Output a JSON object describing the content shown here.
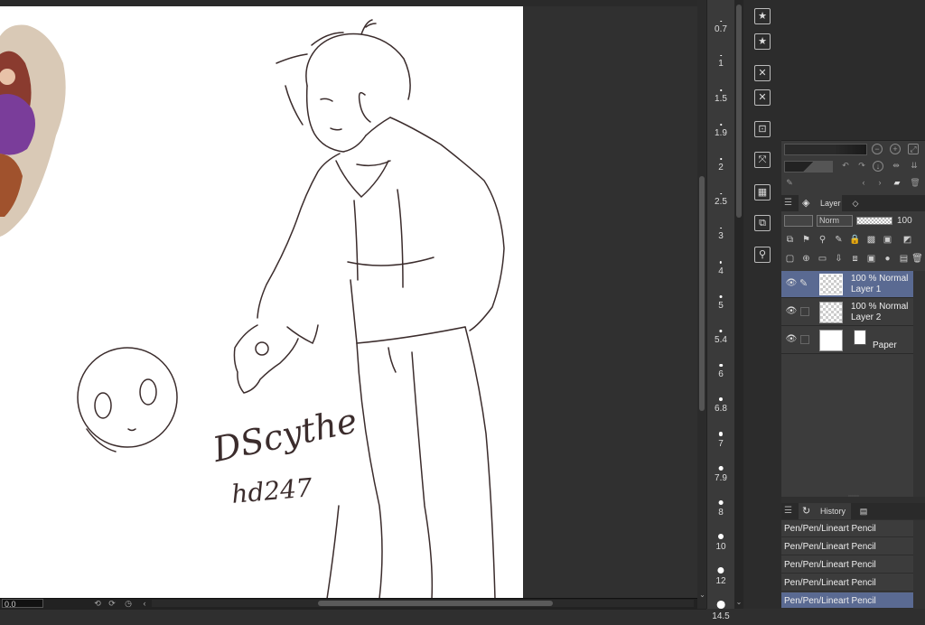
{
  "canvas": {
    "signature_line1": "DScythe",
    "signature_line2": "hd247"
  },
  "bottom_bar": {
    "zoom_value": "0.0"
  },
  "brush_size_palette": {
    "sizes": [
      "0.7",
      "1",
      "1.5",
      "1.9",
      "2",
      "2.5",
      "3",
      "4",
      "5",
      "5.4",
      "6",
      "6.8",
      "7",
      "7.9",
      "8",
      "10",
      "12",
      "14.5"
    ]
  },
  "layer_panel": {
    "tab_label": "Layer",
    "blend_mode": "Norm",
    "opacity": "100",
    "layers": [
      {
        "line1": "100 % Normal",
        "line2": "Layer 1",
        "selected": true
      },
      {
        "line1": "100 % Normal",
        "line2": "Layer 2",
        "selected": false
      },
      {
        "line1": "",
        "line2": "Paper",
        "selected": false
      }
    ]
  },
  "history_panel": {
    "tab_label": "History",
    "items": [
      "Pen/Pen/Lineart Pencil",
      "Pen/Pen/Lineart Pencil",
      "Pen/Pen/Lineart Pencil",
      "Pen/Pen/Lineart Pencil",
      "Pen/Pen/Lineart Pencil"
    ]
  },
  "colors": {
    "selection": "#5a6a92",
    "sketch_line": "#3b2c2c",
    "canvas_bg": "#ffffff"
  }
}
